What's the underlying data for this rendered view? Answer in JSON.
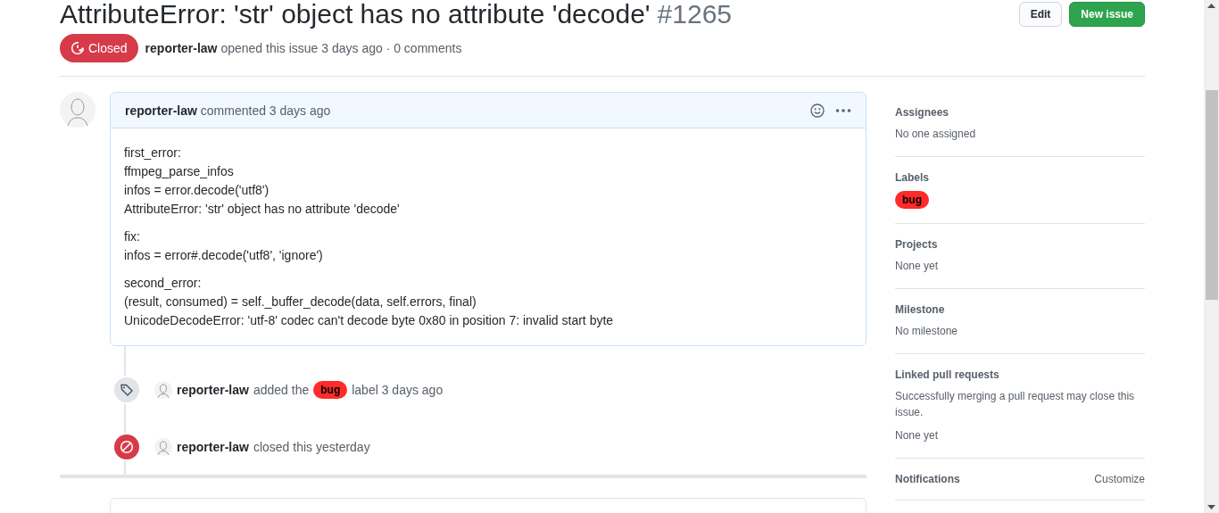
{
  "issue": {
    "title": "AttributeError: 'str' object has no attribute 'decode'",
    "number": "#1265",
    "state": "Closed",
    "author": "reporter-law",
    "meta": "opened this issue 3 days ago · 0 comments"
  },
  "buttons": [
    {
      "label": "Edit",
      "kind": "default"
    },
    {
      "label": "New issue",
      "kind": "primary"
    }
  ],
  "comment": {
    "author": "reporter-law",
    "meta": "commented 3 days ago",
    "paragraphs": [
      [
        "first_error:",
        "ffmpeg_parse_infos",
        "infos = error.decode('utf8')",
        "AttributeError: 'str' object has no attribute 'decode'"
      ],
      [
        "fix:",
        "infos = error#.decode('utf8', 'ignore')"
      ],
      [
        "second_error:",
        "(result, consumed) = self._buffer_decode(data, self.errors, final)",
        "UnicodeDecodeError: 'utf-8' codec can't decode byte 0x80 in position 7: invalid start byte"
      ]
    ]
  },
  "events": [
    {
      "kind": "labeled",
      "author": "reporter-law",
      "before": "added the",
      "label": {
        "name": "bug",
        "color": "#ff2a2a"
      },
      "after": "label 3 days ago"
    },
    {
      "kind": "closed",
      "author": "reporter-law",
      "after": "closed this yesterday"
    }
  ],
  "sidebar": [
    {
      "heading": "Assignees",
      "lines": [
        "No one assigned"
      ]
    },
    {
      "heading": "Labels",
      "labels": [
        {
          "name": "bug",
          "color": "#ff2a2a"
        }
      ]
    },
    {
      "heading": "Projects",
      "lines": [
        "None yet"
      ]
    },
    {
      "heading": "Milestone",
      "lines": [
        "No milestone"
      ]
    },
    {
      "heading": "Linked pull requests",
      "lines": [
        "Successfully merging a pull request may close this issue.",
        "None yet"
      ]
    },
    {
      "heading": "Notifications",
      "action": "Customize"
    }
  ]
}
